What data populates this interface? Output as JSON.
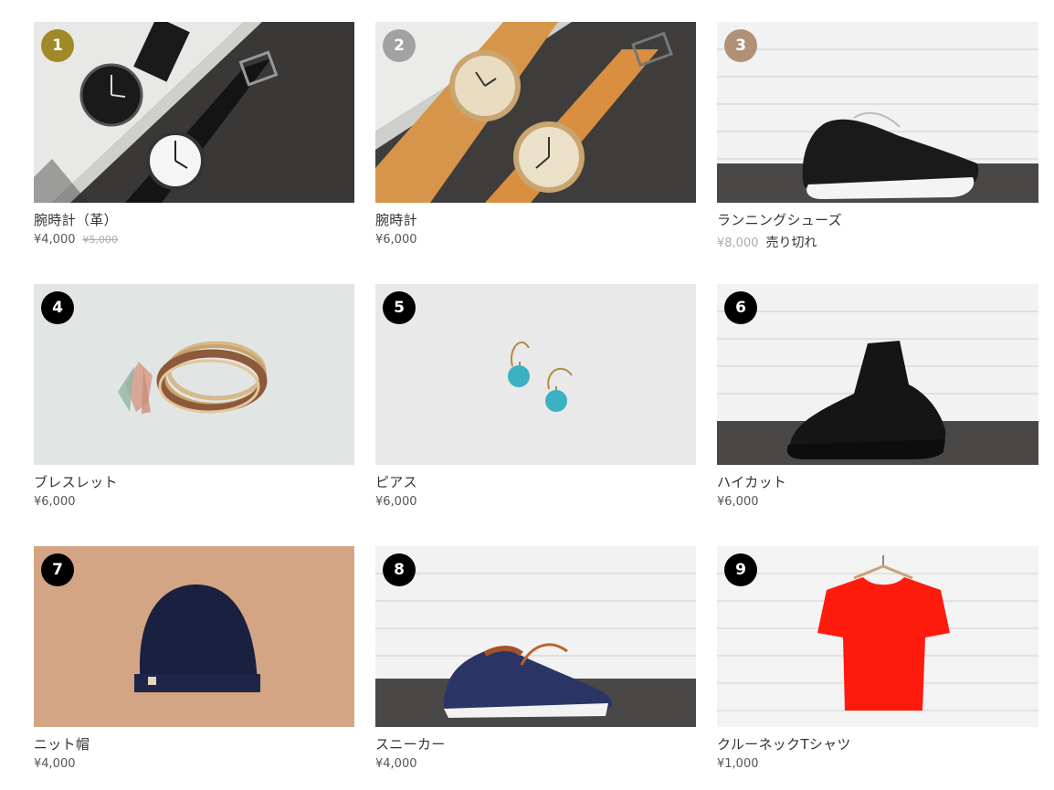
{
  "products": [
    {
      "rank": "1",
      "rank_color": "#a08a28",
      "name": "腕時計（革）",
      "price": "¥4,000",
      "old_price": "¥5,000",
      "status": ""
    },
    {
      "rank": "2",
      "rank_color": "#a2a2a2",
      "name": "腕時計",
      "price": "¥6,000",
      "old_price": "",
      "status": ""
    },
    {
      "rank": "3",
      "rank_color": "#b09076",
      "name": "ランニングシューズ",
      "price": "¥8,000",
      "old_price": "",
      "status": "売り切れ"
    },
    {
      "rank": "4",
      "rank_color": "#000000",
      "name": "ブレスレット",
      "price": "¥6,000",
      "old_price": "",
      "status": ""
    },
    {
      "rank": "5",
      "rank_color": "#000000",
      "name": "ピアス",
      "price": "¥6,000",
      "old_price": "",
      "status": ""
    },
    {
      "rank": "6",
      "rank_color": "#000000",
      "name": "ハイカット",
      "price": "¥6,000",
      "old_price": "",
      "status": ""
    },
    {
      "rank": "7",
      "rank_color": "#000000",
      "name": "ニット帽",
      "price": "¥4,000",
      "old_price": "",
      "status": ""
    },
    {
      "rank": "8",
      "rank_color": "#000000",
      "name": "スニーカー",
      "price": "¥4,000",
      "old_price": "",
      "status": ""
    },
    {
      "rank": "9",
      "rank_color": "#000000",
      "name": "クルーネックTシャツ",
      "price": "¥1,000",
      "old_price": "",
      "status": ""
    }
  ]
}
